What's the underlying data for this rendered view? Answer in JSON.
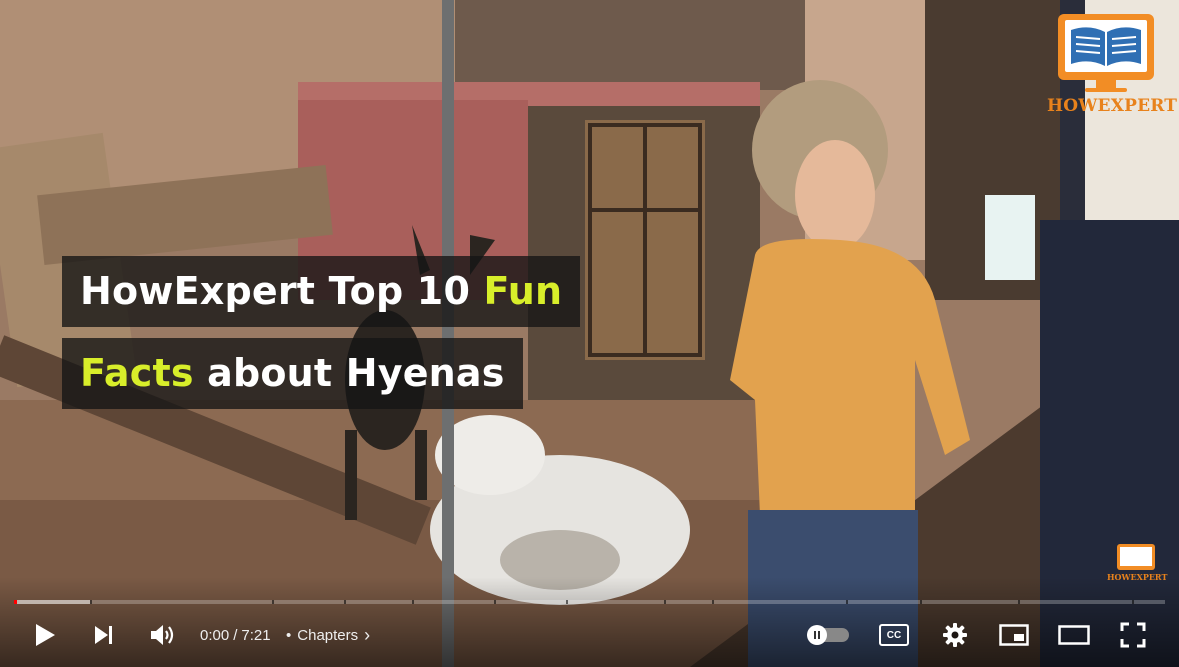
{
  "overlay": {
    "title_line1_plain": "HowExpert Top 10 ",
    "title_line1_highlight": "Fun",
    "title_line2_highlight": "Facts",
    "title_line2_plain": " about Hyenas",
    "highlight_color": "#d8ee2a"
  },
  "brand": {
    "logo_text": "HOWEXPERT",
    "watermark_text": "HOWEXPERT",
    "brand_color": "#f28d25"
  },
  "player": {
    "current_time": "0:00",
    "time_separator": "/",
    "duration": "7:21",
    "chapters_dot": "•",
    "chapters_label": "Chapters",
    "chapters_chevron": "›",
    "progress_played_fraction": 0.003,
    "progress_loaded_fraction": 0.066,
    "cc_label": "CC",
    "progress_color": "#ff0000"
  },
  "icons": {
    "play": "play-icon",
    "next": "skip-next-icon",
    "volume": "volume-icon",
    "autoplay": "autoplay-toggle-icon",
    "captions": "captions-icon",
    "settings": "gear-icon",
    "miniplayer": "miniplayer-icon",
    "theater": "theater-mode-icon",
    "fullscreen": "fullscreen-icon"
  }
}
